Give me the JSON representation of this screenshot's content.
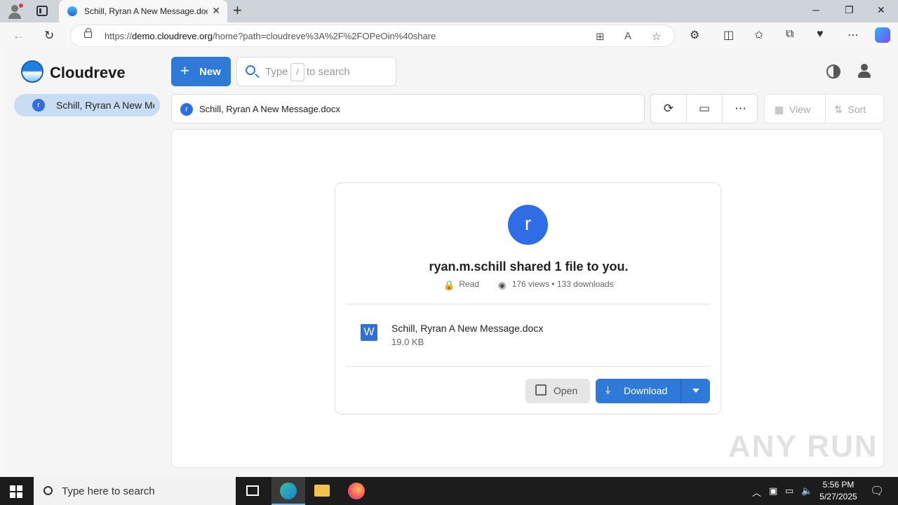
{
  "browser": {
    "tab_title": "Schill, Ryran A New Message.docx",
    "url_prefix": "https://",
    "url_host": "demo.cloudreve.org",
    "url_path": "/home?path=cloudreve%3A%2F%2FOPeOin%40share"
  },
  "app": {
    "brand": "Cloudreve",
    "new_label": "New",
    "search": {
      "prefix": "Type",
      "key": "/",
      "suffix": "to search"
    },
    "sidebar": {
      "item_avatar": "r",
      "item_label": "Schill, Ryran A New Message.docx"
    },
    "breadcrumb": {
      "avatar": "r",
      "label": "Schill, Ryran A New Message.docx"
    },
    "view_label": "View",
    "sort_label": "Sort"
  },
  "share": {
    "avatar": "r",
    "headline": "ryan.m.schill shared 1 file to you.",
    "permission": "Read",
    "stats": "176 views • 133 downloads",
    "file": {
      "icon_letter": "W",
      "name": "Schill, Ryran A New Message.docx",
      "size": "19.0 KB"
    },
    "open_label": "Open",
    "download_label": "Download"
  },
  "taskbar": {
    "search_placeholder": "Type here to search",
    "time": "5:56 PM",
    "date": "5/27/2025"
  },
  "watermark": "ANY RUN",
  "colors": {
    "primary": "#2f79d8",
    "avatar": "#2f6de6",
    "sidebar_active": "#c8dcf4"
  }
}
